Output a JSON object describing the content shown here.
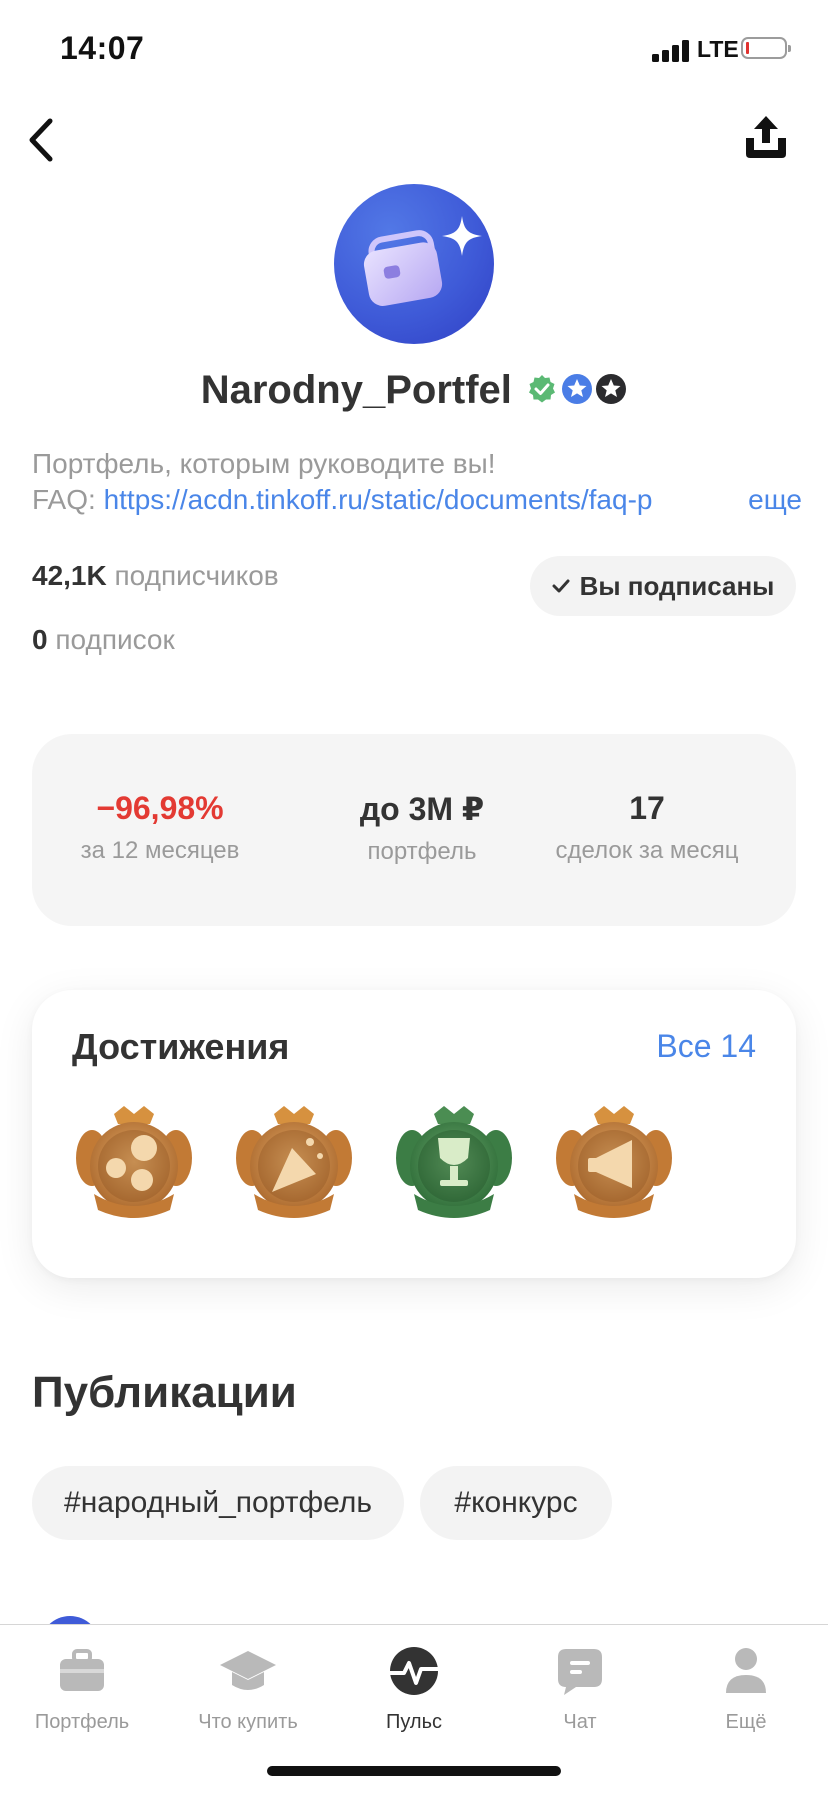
{
  "status_bar": {
    "time": "14:07",
    "network": "LTE",
    "battery_level": 0.07
  },
  "profile": {
    "username": "Narodny_Portfel",
    "bio_line1": "Портфель, которым руководите вы!",
    "bio_prefix": "FAQ: ",
    "bio_link": "https://acdn.tinkoff.ru/static/documents/faq-p",
    "bio_more": "еще",
    "followers_count": "42,1K",
    "followers_label": " подписчиков",
    "following_count": "0",
    "following_label": " подписок",
    "subscribe_button": "Вы подписаны"
  },
  "stats": [
    {
      "value": "−96,98%",
      "label": "за 12 месяцев"
    },
    {
      "value": "до 3M ₽",
      "label": "портфель"
    },
    {
      "value": "17",
      "label": "сделок за месяц"
    }
  ],
  "achievements": {
    "title": "Достижения",
    "all_link": "Все 14",
    "medals": [
      "likes-medal-icon",
      "party-medal-icon",
      "trophy-medal-icon",
      "megaphone-medal-icon"
    ]
  },
  "publications": {
    "title": "Публикации",
    "tags": [
      "#народный_портфель",
      "#конкурс"
    ]
  },
  "tabbar": [
    {
      "label": "Портфель",
      "icon": "briefcase-icon",
      "active": false
    },
    {
      "label": "Что купить",
      "icon": "graduation-cap-icon",
      "active": false
    },
    {
      "label": "Пульс",
      "icon": "pulse-icon",
      "active": true
    },
    {
      "label": "Чат",
      "icon": "chat-icon",
      "active": false
    },
    {
      "label": "Ещё",
      "icon": "profile-more-icon",
      "active": false
    }
  ],
  "colors": {
    "accent": "#4a86e8",
    "negative": "#e33a33",
    "avatar": "#3f5bd8",
    "verified_badge": "#5bb974"
  }
}
